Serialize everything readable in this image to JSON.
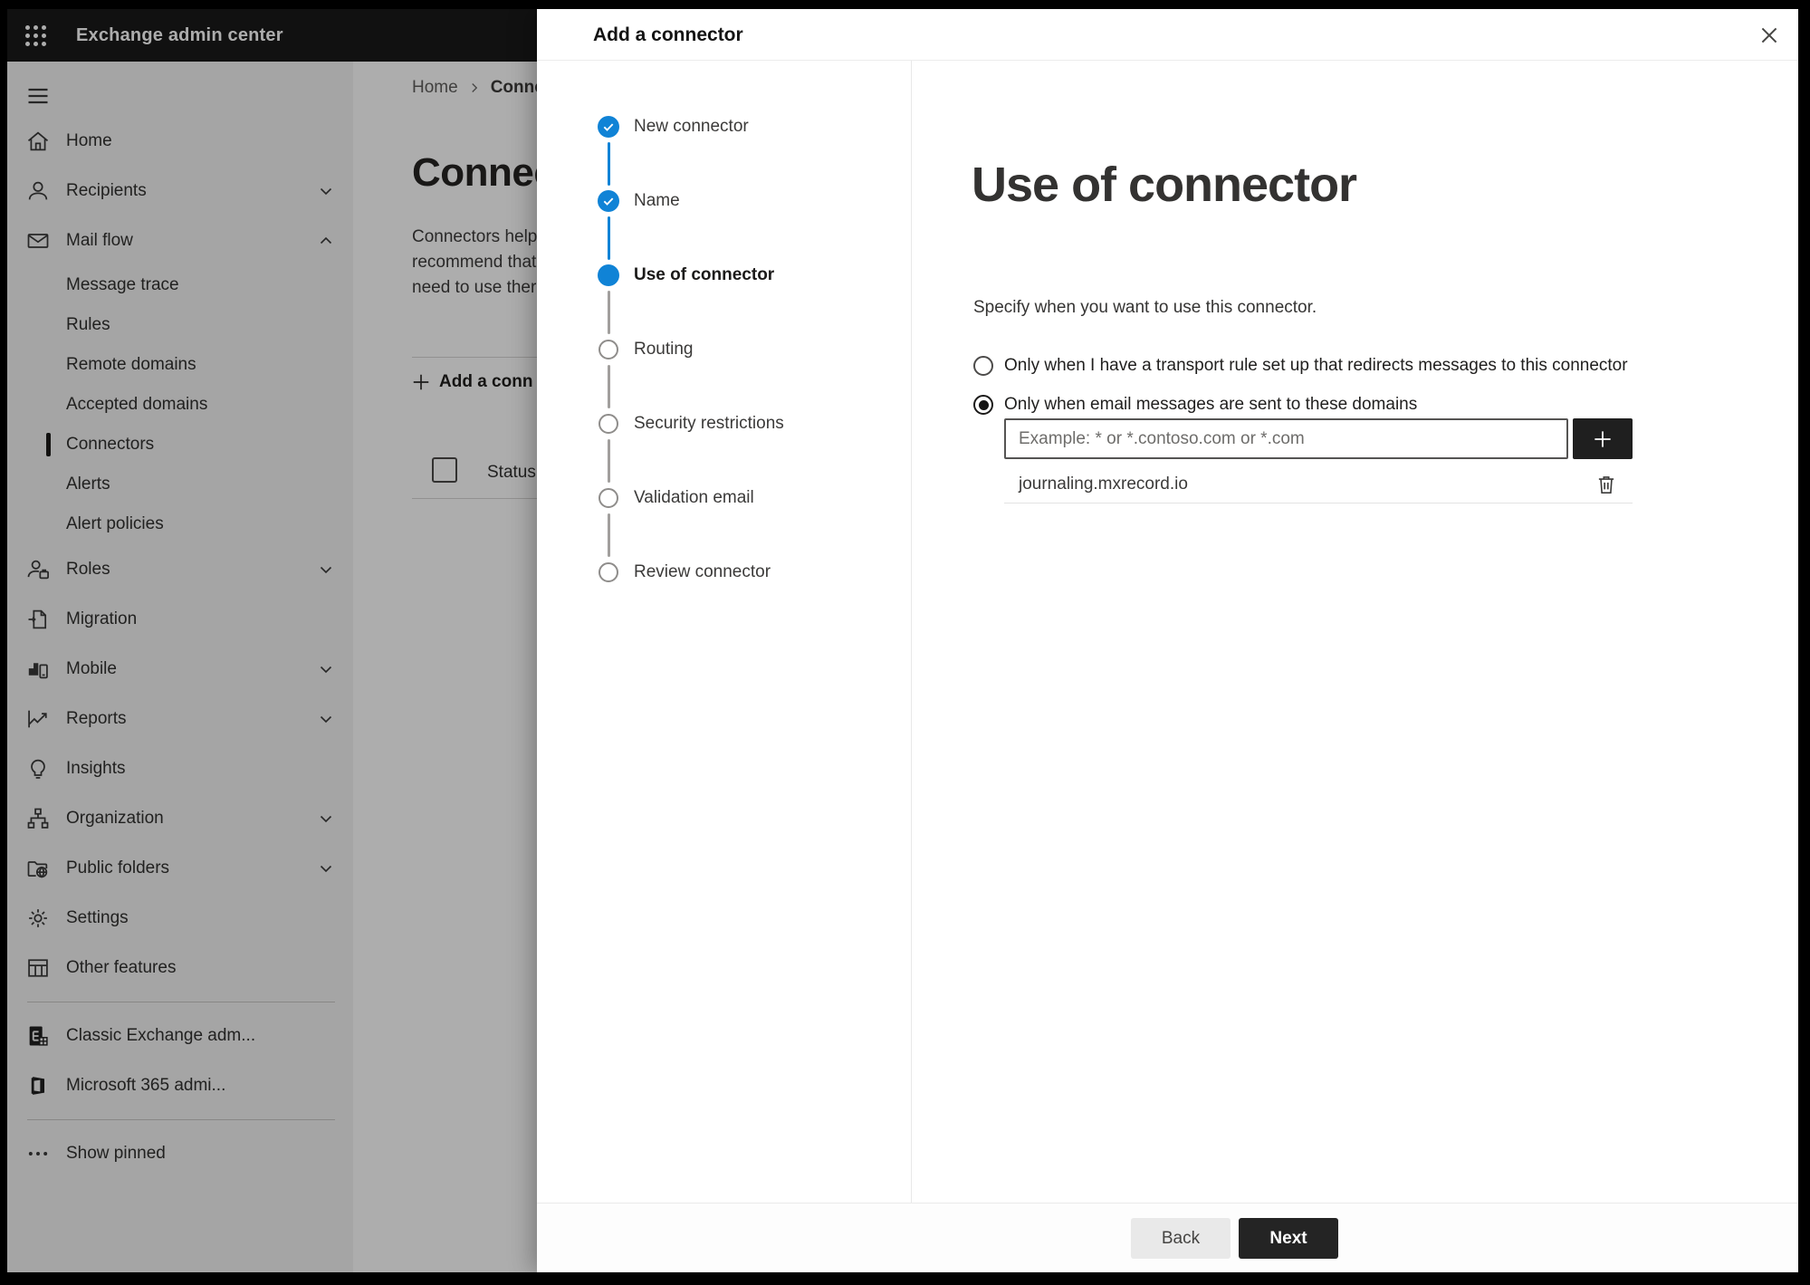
{
  "topbar": {
    "title": "Exchange admin center"
  },
  "sidebar": {
    "items": [
      {
        "label": "Home",
        "icon": "home"
      },
      {
        "label": "Recipients",
        "icon": "person",
        "chevron": "down"
      },
      {
        "label": "Mail flow",
        "icon": "mail",
        "chevron": "up"
      },
      {
        "label": "Message trace",
        "sub": true
      },
      {
        "label": "Rules",
        "sub": true
      },
      {
        "label": "Remote domains",
        "sub": true
      },
      {
        "label": "Accepted domains",
        "sub": true
      },
      {
        "label": "Connectors",
        "sub": true,
        "selected": true
      },
      {
        "label": "Alerts",
        "sub": true
      },
      {
        "label": "Alert policies",
        "sub": true
      },
      {
        "label": "Roles",
        "icon": "roles",
        "chevron": "down"
      },
      {
        "label": "Migration",
        "icon": "migration"
      },
      {
        "label": "Mobile",
        "icon": "mobile",
        "chevron": "down"
      },
      {
        "label": "Reports",
        "icon": "reports",
        "chevron": "down"
      },
      {
        "label": "Insights",
        "icon": "insights"
      },
      {
        "label": "Organization",
        "icon": "organization",
        "chevron": "down"
      },
      {
        "label": "Public folders",
        "icon": "folders",
        "chevron": "down"
      },
      {
        "label": "Settings",
        "icon": "settings"
      },
      {
        "label": "Other features",
        "icon": "grid"
      },
      {
        "divider": true
      },
      {
        "label": "Classic Exchange adm...",
        "icon": "exchange"
      },
      {
        "label": "Microsoft 365 admi...",
        "icon": "office"
      },
      {
        "divider": true
      },
      {
        "label": "Show pinned",
        "icon": "ellipsis"
      }
    ]
  },
  "background_page": {
    "breadcrumb": {
      "first": "Home",
      "second": "Conne"
    },
    "title": "Connect",
    "description_lines": [
      "Connectors help",
      "recommend that",
      "need to use ther"
    ],
    "add_button_label": "Add a conn",
    "table_header": "Status"
  },
  "dialog": {
    "title": "Add a connector",
    "steps": [
      {
        "label": "New connector",
        "state": "completed"
      },
      {
        "label": "Name",
        "state": "completed"
      },
      {
        "label": "Use of connector",
        "state": "current"
      },
      {
        "label": "Routing",
        "state": "upcoming"
      },
      {
        "label": "Security restrictions",
        "state": "upcoming"
      },
      {
        "label": "Validation email",
        "state": "upcoming"
      },
      {
        "label": "Review connector",
        "state": "upcoming"
      }
    ],
    "content": {
      "heading": "Use of connector",
      "description": "Specify when you want to use this connector.",
      "radio_options": [
        {
          "label": "Only when I have a transport rule set up that redirects messages to this connector",
          "selected": false
        },
        {
          "label": "Only when email messages are sent to these domains",
          "selected": true
        }
      ],
      "domain_input_placeholder": "Example: * or *.contoso.com or *.com",
      "domains": [
        "journaling.mxrecord.io"
      ]
    },
    "footer": {
      "back_label": "Back",
      "next_label": "Next"
    }
  },
  "colors": {
    "accent_blue": "#1083d6",
    "next_button": "#242424",
    "topbar": "#1a1a1a"
  }
}
